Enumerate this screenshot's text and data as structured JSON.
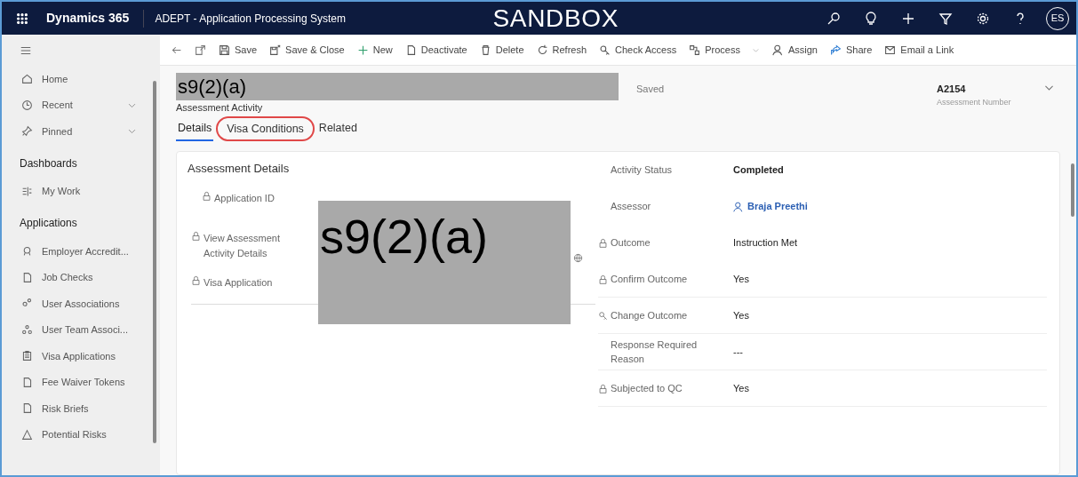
{
  "top_bar": {
    "app_name": "Dynamics 365",
    "app_title": "ADEPT - Application Processing System",
    "environment": "SANDBOX",
    "avatar": "ES"
  },
  "sidebar": {
    "items": [
      {
        "kind": "item",
        "label": "Home",
        "chevron": false
      },
      {
        "kind": "item",
        "label": "Recent",
        "chevron": true
      },
      {
        "kind": "item",
        "label": "Pinned",
        "chevron": true
      },
      {
        "kind": "heading",
        "label": "Dashboards"
      },
      {
        "kind": "item",
        "label": "My Work",
        "chevron": false
      },
      {
        "kind": "heading",
        "label": "Applications"
      },
      {
        "kind": "item",
        "label": "Employer Accredit...",
        "chevron": false
      },
      {
        "kind": "item",
        "label": "Job Checks",
        "chevron": false
      },
      {
        "kind": "item",
        "label": "User Associations",
        "chevron": false
      },
      {
        "kind": "item",
        "label": "User Team Associ...",
        "chevron": false
      },
      {
        "kind": "item",
        "label": "Visa Applications",
        "chevron": false
      },
      {
        "kind": "item",
        "label": "Fee Waiver Tokens",
        "chevron": false
      },
      {
        "kind": "item",
        "label": "Risk Briefs",
        "chevron": false
      },
      {
        "kind": "item",
        "label": "Potential Risks",
        "chevron": false
      }
    ]
  },
  "toolbar": [
    {
      "label": "Save",
      "dropdown": false
    },
    {
      "label": "Save & Close",
      "dropdown": false
    },
    {
      "label": "New",
      "dropdown": false
    },
    {
      "label": "Deactivate",
      "dropdown": false
    },
    {
      "label": "Delete",
      "dropdown": false
    },
    {
      "label": "Refresh",
      "dropdown": false
    },
    {
      "label": "Check Access",
      "dropdown": false
    },
    {
      "label": "Process",
      "dropdown": true
    },
    {
      "label": "Assign",
      "dropdown": false
    },
    {
      "label": "Share",
      "dropdown": false
    },
    {
      "label": "Email a Link",
      "dropdown": false
    }
  ],
  "header": {
    "title_redaction": "s9(2)(a)",
    "entity": "Assessment Activity",
    "save_state": "Saved",
    "number": "A2154",
    "number_label": "Assessment Number"
  },
  "tabs": [
    {
      "label": "Details",
      "selected": true,
      "circled": false
    },
    {
      "label": "Visa Conditions",
      "selected": false,
      "circled": true
    },
    {
      "label": "Related",
      "selected": false,
      "circled": false
    }
  ],
  "section": {
    "title": "Assessment Details",
    "left_fields": [
      {
        "label": "Application ID",
        "locked": true
      },
      {
        "label": "View Assessment Activity Details",
        "locked": true
      },
      {
        "label": "Visa Application",
        "locked": true
      }
    ],
    "redaction": "s9(2)(a)",
    "right_fields": [
      {
        "label": "Activity Status",
        "locked": false,
        "value": "Completed",
        "kind": "bold"
      },
      {
        "label": "Assessor",
        "locked": false,
        "value": "Braja Preethi",
        "kind": "lookup"
      },
      {
        "label": "Outcome",
        "locked": true,
        "value": "Instruction Met",
        "kind": "text"
      },
      {
        "label": "Confirm Outcome",
        "locked": true,
        "value": "Yes",
        "kind": "text"
      },
      {
        "label": "Change Outcome",
        "locked": false,
        "value": "Yes",
        "kind": "text"
      },
      {
        "label": "Response Required Reason",
        "locked": false,
        "value": "---",
        "kind": "text"
      },
      {
        "label": "Subjected to QC",
        "locked": true,
        "value": "Yes",
        "kind": "text"
      }
    ]
  }
}
